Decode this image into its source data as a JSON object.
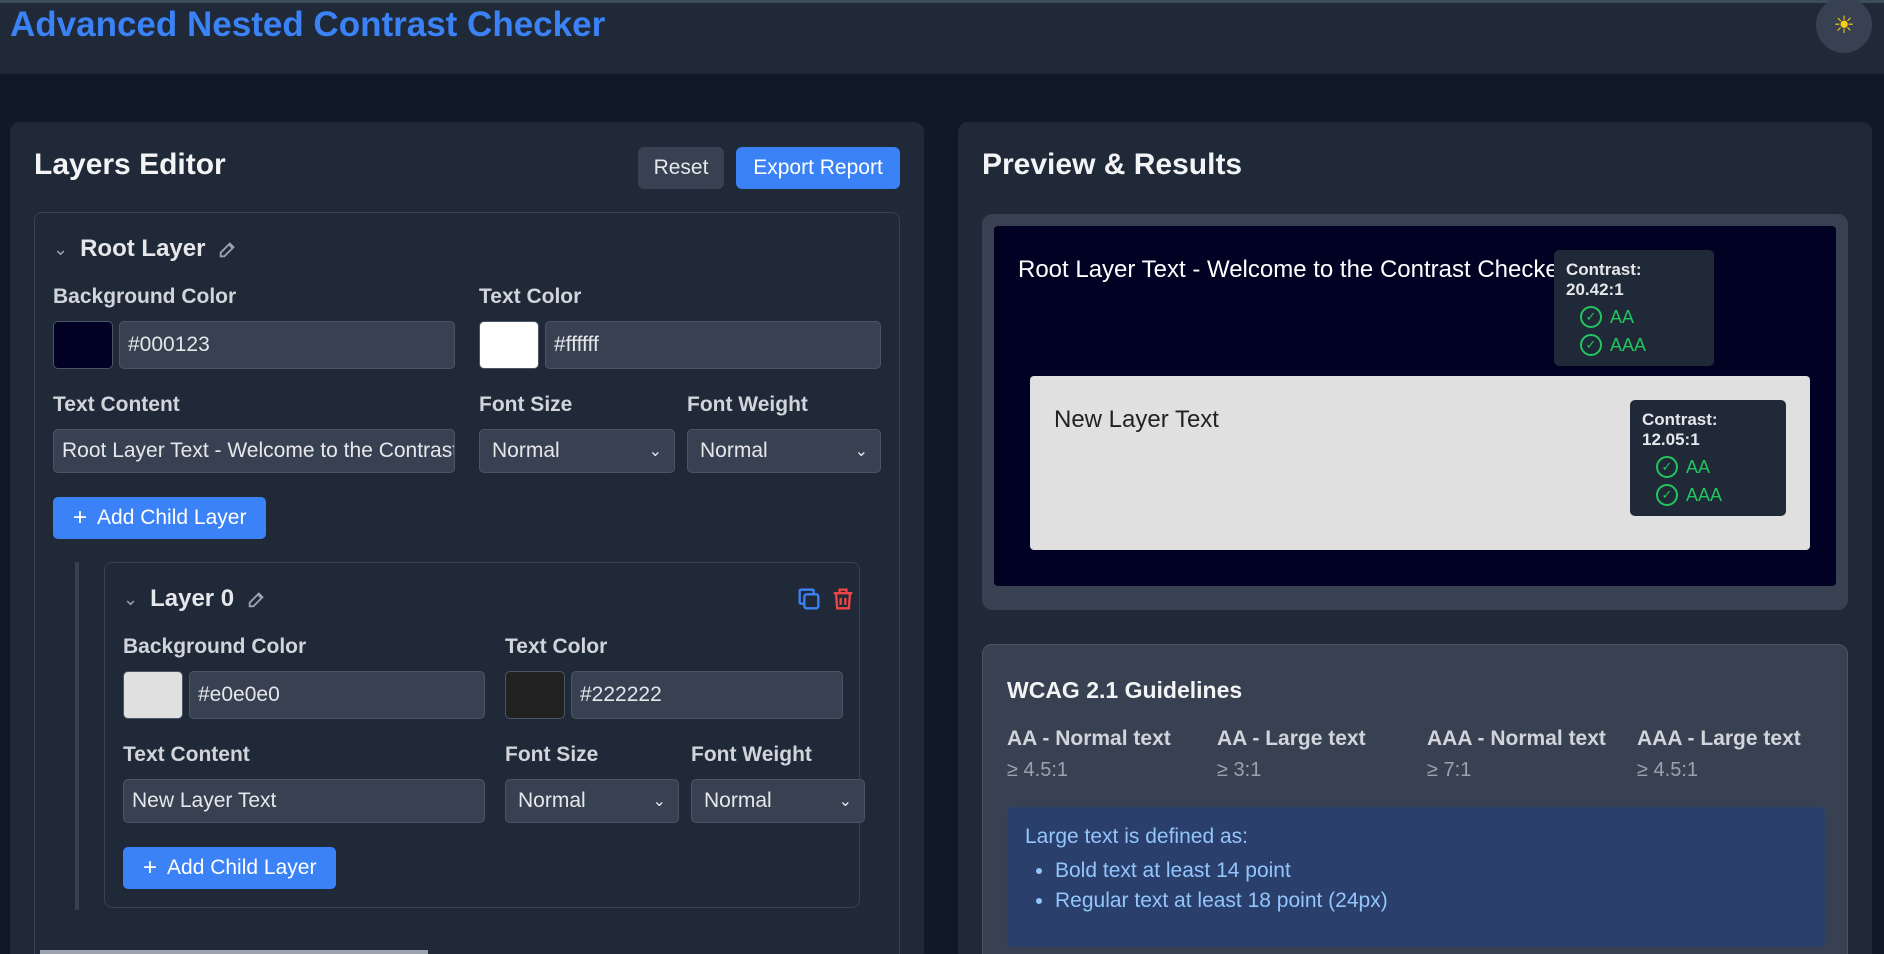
{
  "header": {
    "title": "Advanced Nested Contrast Checker",
    "theme_icon": "☀"
  },
  "editor": {
    "title": "Layers Editor",
    "reset_label": "Reset",
    "export_label": "Export Report",
    "root": {
      "name": "Root Layer",
      "bg_label": "Background Color",
      "bg_value": "#000123",
      "text_color_label": "Text Color",
      "text_color_value": "#ffffff",
      "content_label": "Text Content",
      "content_value": "Root Layer Text - Welcome to the Contrast Checker",
      "font_size_label": "Font Size",
      "font_size_value": "Normal",
      "font_weight_label": "Font Weight",
      "font_weight_value": "Normal",
      "add_child_label": "Add Child Layer"
    },
    "child": {
      "name": "Layer 0",
      "bg_label": "Background Color",
      "bg_value": "#e0e0e0",
      "text_color_label": "Text Color",
      "text_color_value": "#222222",
      "content_label": "Text Content",
      "content_value": "New Layer Text",
      "font_size_label": "Font Size",
      "font_size_value": "Normal",
      "font_weight_label": "Font Weight",
      "font_weight_value": "Normal",
      "add_child_label": "Add Child Layer"
    }
  },
  "preview": {
    "title": "Preview & Results",
    "root_text": "Root Layer Text - Welcome to the Contrast Checker",
    "root_contrast": "Contrast: 20.42:1",
    "child_text": "New Layer Text",
    "child_contrast": "Contrast: 12.05:1",
    "aa": "AA",
    "aaa": "AAA"
  },
  "wcag": {
    "title": "WCAG 2.1 Guidelines",
    "guides": [
      {
        "label": "AA - Normal text",
        "value": "≥ 4.5:1"
      },
      {
        "label": "AA - Large text",
        "value": "≥ 3:1"
      },
      {
        "label": "AAA - Normal text",
        "value": "≥ 7:1"
      },
      {
        "label": "AAA - Large text",
        "value": "≥ 4.5:1"
      }
    ],
    "note_head": "Large text is defined as:",
    "note_items": [
      "Bold text at least 14 point",
      "Regular text at least 18 point (24px)"
    ]
  },
  "colors": {
    "accent": "#3b82f6",
    "pass": "#22c55e",
    "danger": "#ef4444"
  }
}
